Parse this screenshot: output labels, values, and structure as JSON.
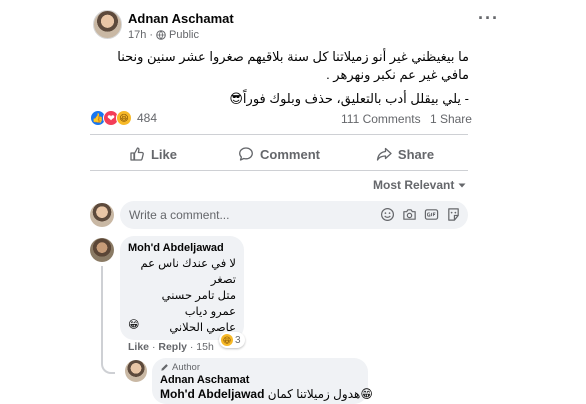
{
  "post": {
    "author": "Adnan Aschamat",
    "time": "17h",
    "separator": "·",
    "privacy": "Public",
    "menu_dots": "···",
    "text_line1": "ما بيغيظني غير أنو زميلاتنا كل سنة بلاقيهم صغروا عشر سنين ونحنا مافي غير عم نكبر ونهرهر .",
    "text_line2": "- يلي بيقلل أدب بالتعليق، حذف وبلوك فوراً😎"
  },
  "reactions": {
    "count": "484",
    "like_glyph": "👍",
    "love_glyph": "❤",
    "haha_glyph": "😆"
  },
  "stats": {
    "comments": "111 Comments",
    "shares": "1 Share"
  },
  "actions": {
    "like": "Like",
    "comment": "Comment",
    "share": "Share"
  },
  "sort": {
    "label": "Most Relevant"
  },
  "composer": {
    "placeholder": "Write a comment..."
  },
  "comment1": {
    "author": "Moh'd Abdeljawad",
    "lines": [
      "لا في عندك ناس عم تصغر",
      "متل تامر حسني",
      "عمرو دياب",
      "عاصي الحلاني"
    ],
    "emoji": "😁",
    "reaction_count": "3",
    "reaction_glyph": "😆",
    "like": "Like",
    "reply": "Reply",
    "dot": "·",
    "time": "15h"
  },
  "reply1": {
    "badge": "Author",
    "author": "Adnan Aschamat",
    "mention": "Moh'd Abdeljawad",
    "text": "هدول زميلاتنا كمان😁"
  },
  "colors": {
    "accent": "#1877f2",
    "text_secondary": "#65676b",
    "bubble": "#f0f2f5",
    "divider": "#ced0d4"
  }
}
